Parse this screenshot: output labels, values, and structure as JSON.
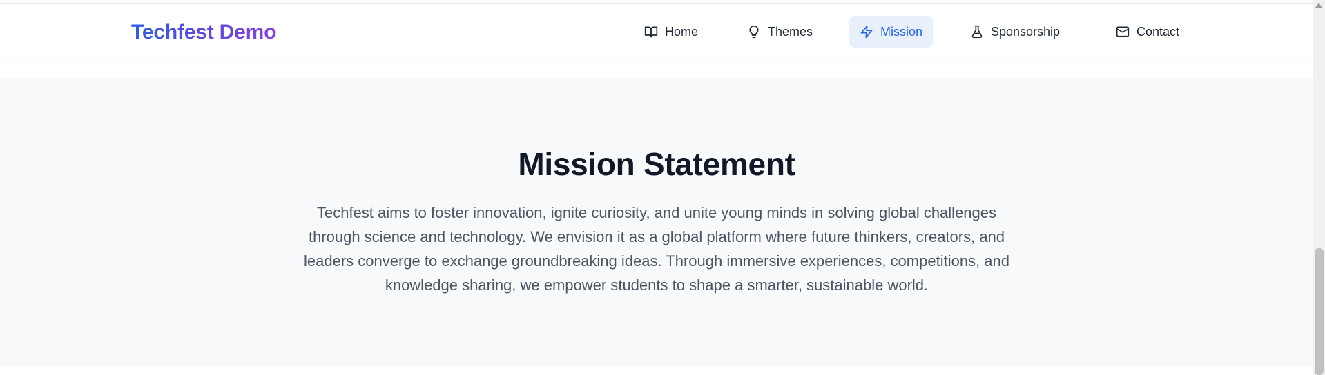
{
  "brand": {
    "name": "Techfest Demo"
  },
  "nav": {
    "items": [
      {
        "label": "Home",
        "icon": "book-open-icon"
      },
      {
        "label": "Themes",
        "icon": "lightbulb-icon"
      },
      {
        "label": "Mission",
        "icon": "zap-icon",
        "active": true
      },
      {
        "label": "Sponsorship",
        "icon": "flask-icon"
      },
      {
        "label": "Contact",
        "icon": "mail-icon"
      }
    ]
  },
  "mission": {
    "title": "Mission Statement",
    "body": "Techfest aims to foster innovation, ignite curiosity, and unite young minds in solving global challenges through science and technology. We envision it as a global platform where future thinkers, creators, and leaders converge to exchange groundbreaking ideas. Through immersive experiences, competitions, and knowledge sharing, we empower students to shape a smarter, sustainable world."
  },
  "colors": {
    "accent": "#2563eb",
    "brand_gradient_start": "#2f5de6",
    "brand_gradient_end": "#8a3fe0",
    "section_bg": "#f8f9fa",
    "active_nav_bg": "#e7f0fb",
    "heading": "#111827",
    "body_text": "#4b5563"
  }
}
